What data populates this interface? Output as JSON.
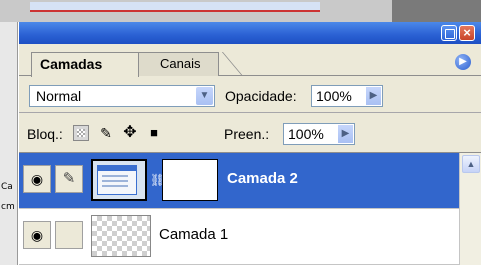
{
  "panel": {
    "close_glyph": "×"
  },
  "tabs": [
    {
      "label": "Camadas",
      "active": true
    },
    {
      "label": "Canais",
      "active": false
    }
  ],
  "blend": {
    "mode": "Normal",
    "opacity_label": "Opacidade:",
    "opacity_value": "100%"
  },
  "lock": {
    "label": "Bloq.:",
    "fill_label": "Preen.:",
    "fill_value": "100%"
  },
  "layers": [
    {
      "name": "Camada 2",
      "selected": true,
      "visible": true,
      "has_mask": true
    },
    {
      "name": "Camada 1",
      "selected": false,
      "visible": true,
      "has_mask": false
    }
  ],
  "icons": {
    "eye": "eye-icon",
    "brush": "brush-icon",
    "move": "move-icon",
    "lock": "lock-icon",
    "chain": "chain-link-icon",
    "menu": "panel-menu-icon"
  },
  "colors": {
    "titlebar": "#2a60d3",
    "selected_row": "#3266cc",
    "panel_bg": "#ece9d8"
  }
}
